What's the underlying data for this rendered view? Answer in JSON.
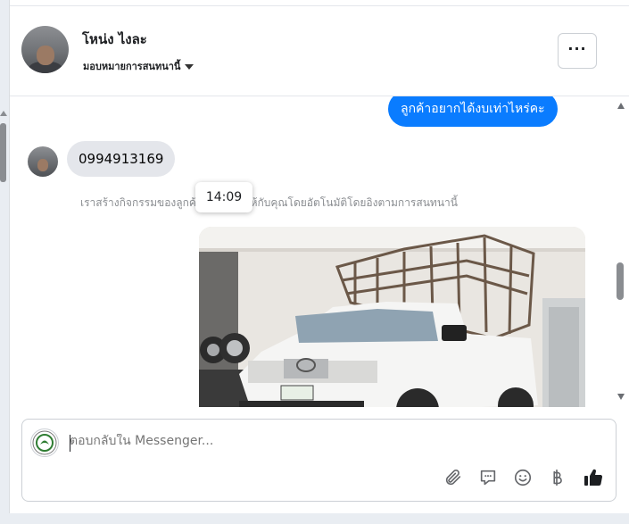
{
  "header": {
    "contact_name": "โหน่ง ไงละ",
    "assign_label": "มอบหมายการสนทนานี้",
    "more_label": "···"
  },
  "messages": {
    "outgoing_text": "ลูกค้าอยากได้งบเท่าไหร่คะ",
    "incoming_text": "0994913169",
    "system_note": "เราสร้างกิจกรรมของลูกค้าเป้าหมายให้กับคุณโดยอัตโนมัติโดยอิงตามการสนทนานี้",
    "timestamp_tooltip": "14:09"
  },
  "composer": {
    "placeholder": "ตอบกลับใน Messenger...",
    "tools": [
      "paperclip-icon",
      "speech-bubble-icon",
      "smiley-icon",
      "baht-icon",
      "thumbs-up-icon"
    ]
  },
  "colors": {
    "accent": "#0a7cff",
    "incoming_bubble": "#e4e6eb",
    "muted_text": "#8a8d91"
  }
}
